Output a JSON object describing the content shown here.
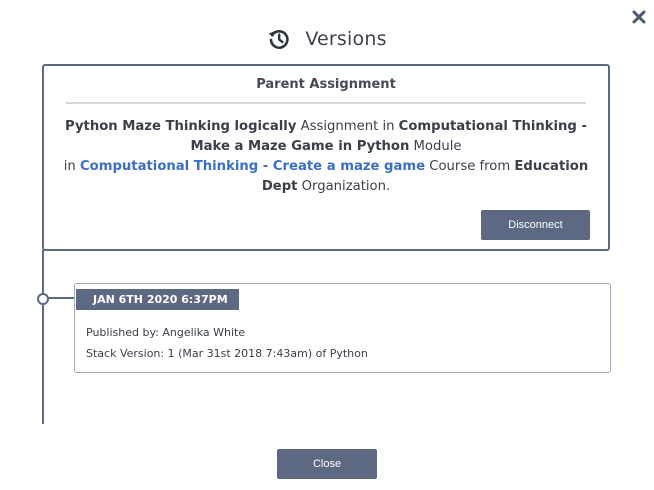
{
  "dialog": {
    "title": "Versions",
    "header_icon": "history-icon",
    "close_icon": "close-icon"
  },
  "parent": {
    "heading": "Parent Assignment",
    "assignment_name": "Python Maze Thinking logically",
    "text_assignment_in": " Assignment in ",
    "module_name": "Computational Thinking - Make a Maze Game in Python",
    "text_module": " Module",
    "text_in": "in ",
    "course_name": "Computational Thinking - Create a maze game",
    "text_course_from": " Course from ",
    "organization_name": "Education Dept",
    "text_organization": " Organization.",
    "disconnect_label": "Disconnect"
  },
  "versions": [
    {
      "date": "JAN 6TH 2020 6:37PM",
      "published_by": "Published by: Angelika White",
      "stack_version": "Stack Version: 1 (Mar 31st 2018 7:43am) of Python"
    }
  ],
  "footer": {
    "close_label": "Close"
  },
  "colors": {
    "accent": "#5d6883",
    "link": "#3b6fc4",
    "text": "#3a3f4a"
  }
}
